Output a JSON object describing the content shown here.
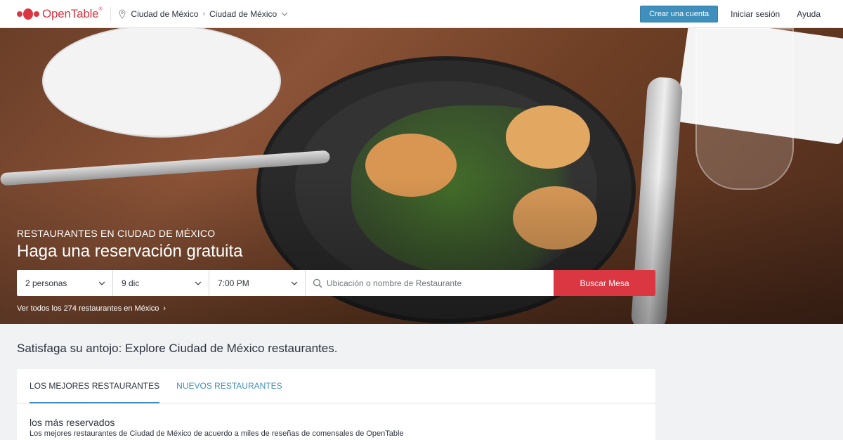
{
  "header": {
    "logo_text": "OpenTable",
    "logo_mark": "®",
    "breadcrumb": [
      "Ciudad de México",
      "Ciudad de México"
    ],
    "create_account": "Crear una cuenta",
    "sign_in": "Iniciar sesión",
    "help": "Ayuda"
  },
  "hero": {
    "subtitle": "RESTAURANTES EN CIUDAD DE MÉXICO",
    "title": "Haga una reservación gratuita",
    "party_size": "2 personas",
    "date": "9 dic",
    "time": "7:00 PM",
    "search_placeholder": "Ubicación o nombre de Restaurante",
    "search_button": "Buscar Mesa",
    "all_restaurants_link": "Ver todos los 274 restaurantes en México"
  },
  "explore": {
    "title": "Satisfaga su antojo: Explore Ciudad de México restaurantes.",
    "tabs": [
      {
        "label": "LOS MEJORES RESTAURANTES"
      },
      {
        "label": "NUEVOS RESTAURANTES"
      }
    ],
    "section_heading": "los más reservados",
    "section_description": "Los mejores restaurantes de Ciudad de México de acuerdo a miles de reseñas de comensales de OpenTable"
  },
  "colors": {
    "brand_red": "#da3743",
    "link_blue": "#3f8fbc",
    "text": "#2d333f"
  },
  "icons": [
    "location-pin-icon",
    "chevron-right-icon",
    "chevron-down-icon",
    "search-icon"
  ]
}
